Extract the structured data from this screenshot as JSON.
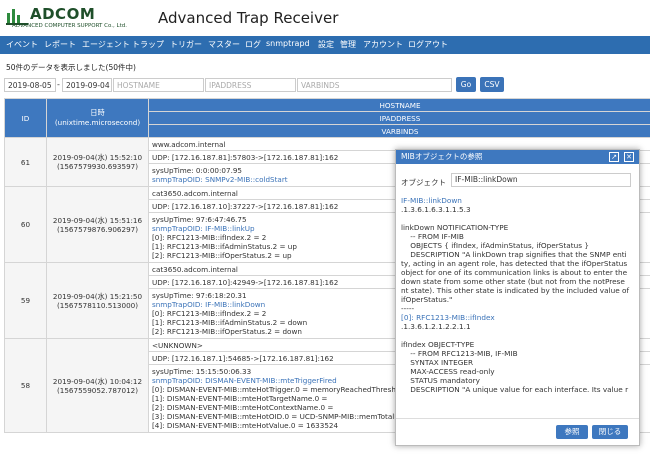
{
  "brand": {
    "name": "ADCOM",
    "tagline": "ADVANCED COMPUTER SUPPORT Co., Ltd.",
    "app_title": "Advanced Trap Receiver"
  },
  "nav": [
    "イベント",
    "レポート",
    "エージェント",
    "トラップ",
    "トリガー",
    "マスター",
    "ログ",
    "snmptrapd",
    "設定",
    "管理",
    "アカウント",
    "ログアウト"
  ],
  "info_text": "50件のデータを表示しました(50件中)",
  "filter": {
    "date_from": "2019-08-05",
    "dash": "-",
    "date_to": "2019-09-04",
    "hostname_ph": "HOSTNAME",
    "ipaddress_ph": "IPADDRESS",
    "varbinds_ph": "VARBINDS",
    "go": "Go",
    "csv": "CSV"
  },
  "table": {
    "headers": {
      "id": "ID",
      "dt1": "日時",
      "dt2": "(unixtime.microsecond)",
      "hostname": "HOSTNAME",
      "ipaddress": "IPADDRESS",
      "varbinds": "VARBINDS"
    },
    "rows": [
      {
        "id": "61",
        "dt": "2019-09-04(水) 15:52:10",
        "ut": "(1567579930.693597)",
        "host": "www.adcom.internal",
        "udp": "UDP: [172.16.187.81]:57803->[172.16.187.81]:162",
        "vb": [
          {
            "t": "sysUpTime: 0:0:00:07.95",
            "b": false
          },
          {
            "t": "snmpTrapOID: SNMPv2-MIB::coldStart",
            "b": true
          }
        ]
      },
      {
        "id": "60",
        "dt": "2019-09-04(水) 15:51:16",
        "ut": "(1567579876.906297)",
        "host": "cat3650.adcom.internal",
        "udp": "UDP: [172.16.187.10]:37227->[172.16.187.81]:162",
        "vb": [
          {
            "t": "sysUpTime: 97:6:47:46.75",
            "b": false
          },
          {
            "t": "snmpTrapOID: IF-MIB::linkUp",
            "b": true
          },
          {
            "t": "[0]: RFC1213-MIB::ifIndex.2 = 2",
            "b": false
          },
          {
            "t": "[1]: RFC1213-MIB::ifAdminStatus.2 = up",
            "b": false
          },
          {
            "t": "[2]: RFC1213-MIB::ifOperStatus.2 = up",
            "b": false
          }
        ]
      },
      {
        "id": "59",
        "dt": "2019-09-04(水) 15:21:50",
        "ut": "(1567578110.513000)",
        "host": "cat3650.adcom.internal",
        "udp": "UDP: [172.16.187.10]:42949->[172.16.187.81]:162",
        "vb": [
          {
            "t": "sysUpTime: 97:6:18:20.31",
            "b": false
          },
          {
            "t": "snmpTrapOID: IF-MIB::linkDown",
            "b": true
          },
          {
            "t": "[0]: RFC1213-MIB::ifIndex.2 = 2",
            "b": false
          },
          {
            "t": "[1]: RFC1213-MIB::ifAdminStatus.2 = down",
            "b": false
          },
          {
            "t": "[2]: RFC1213-MIB::ifOperStatus.2 = down",
            "b": false
          }
        ]
      },
      {
        "id": "58",
        "dt": "2019-09-04(水) 10:04:12",
        "ut": "(1567559052.787012)",
        "host": "<UNKNOWN>",
        "udp": "UDP: [172.16.187.1]:54685->[172.16.187.81]:162",
        "vb": [
          {
            "t": "sysUpTime: 15:15:50:06.33",
            "b": false
          },
          {
            "t": "snmpTrapOID: DISMAN-EVENT-MIB::mteTriggerFired",
            "b": true
          },
          {
            "t": "[0]: DISMAN-EVENT-MIB::mteHotTrigger.0 = memoryReachedThreshold",
            "b": false
          },
          {
            "t": "[1]: DISMAN-EVENT-MIB::mteHotTargetName.0 =",
            "b": false
          },
          {
            "t": "[2]: DISMAN-EVENT-MIB::mteHotContextName.0 =",
            "b": false
          },
          {
            "t": "[3]: DISMAN-EVENT-MIB::mteHotOID.0 = UCD-SNMP-MIB::memTotalReal.0",
            "b": false
          },
          {
            "t": "[4]: DISMAN-EVENT-MIB::mteHotValue.0 = 1633524",
            "b": false
          }
        ]
      }
    ]
  },
  "modal": {
    "title": "MIBオブジェクトの参照",
    "popout_icon": "popout-icon",
    "close_icon": "close-icon",
    "object_label": "オブジェクト",
    "object_value": "IF-MIB::linkDown",
    "lines": [
      {
        "t": "IF-MIB::linkDown",
        "b": true
      },
      {
        "t": ".1.3.6.1.6.3.1.1.5.3",
        "b": false
      },
      {
        "t": "",
        "b": false
      },
      {
        "t": "linkDown NOTIFICATION-TYPE",
        "b": false
      },
      {
        "t": "    -- FROM IF-MIB",
        "b": false
      },
      {
        "t": "    OBJECTS { ifIndex, ifAdminStatus, ifOperStatus }",
        "b": false
      },
      {
        "t": "    DESCRIPTION \"A linkDown trap signifies that the SNMP enti",
        "b": false
      },
      {
        "t": "ty, acting in an agent role, has detected that the ifOperStatus",
        "b": false
      },
      {
        "t": "object for one of its communication links is about to enter the",
        "b": false
      },
      {
        "t": "down state from some other state (but not from the notPrese",
        "b": false
      },
      {
        "t": "nt state). This other state is indicated by the included value of",
        "b": false
      },
      {
        "t": "ifOperStatus.\"",
        "b": false
      },
      {
        "t": "-----",
        "b": false
      },
      {
        "t": "[0]: RFC1213-MIB::ifIndex",
        "b": true
      },
      {
        "t": ".1.3.6.1.2.1.2.2.1.1",
        "b": false
      },
      {
        "t": "",
        "b": false
      },
      {
        "t": "ifIndex OBJECT-TYPE",
        "b": false
      },
      {
        "t": "    -- FROM RFC1213-MIB, IF-MIB",
        "b": false
      },
      {
        "t": "    SYNTAX INTEGER",
        "b": false
      },
      {
        "t": "    MAX-ACCESS read-only",
        "b": false
      },
      {
        "t": "    STATUS mandatory",
        "b": false
      },
      {
        "t": "    DESCRIPTION \"A unique value for each interface. Its value r",
        "b": false
      }
    ],
    "ref_button": "参照",
    "close_button": "閉じる"
  }
}
